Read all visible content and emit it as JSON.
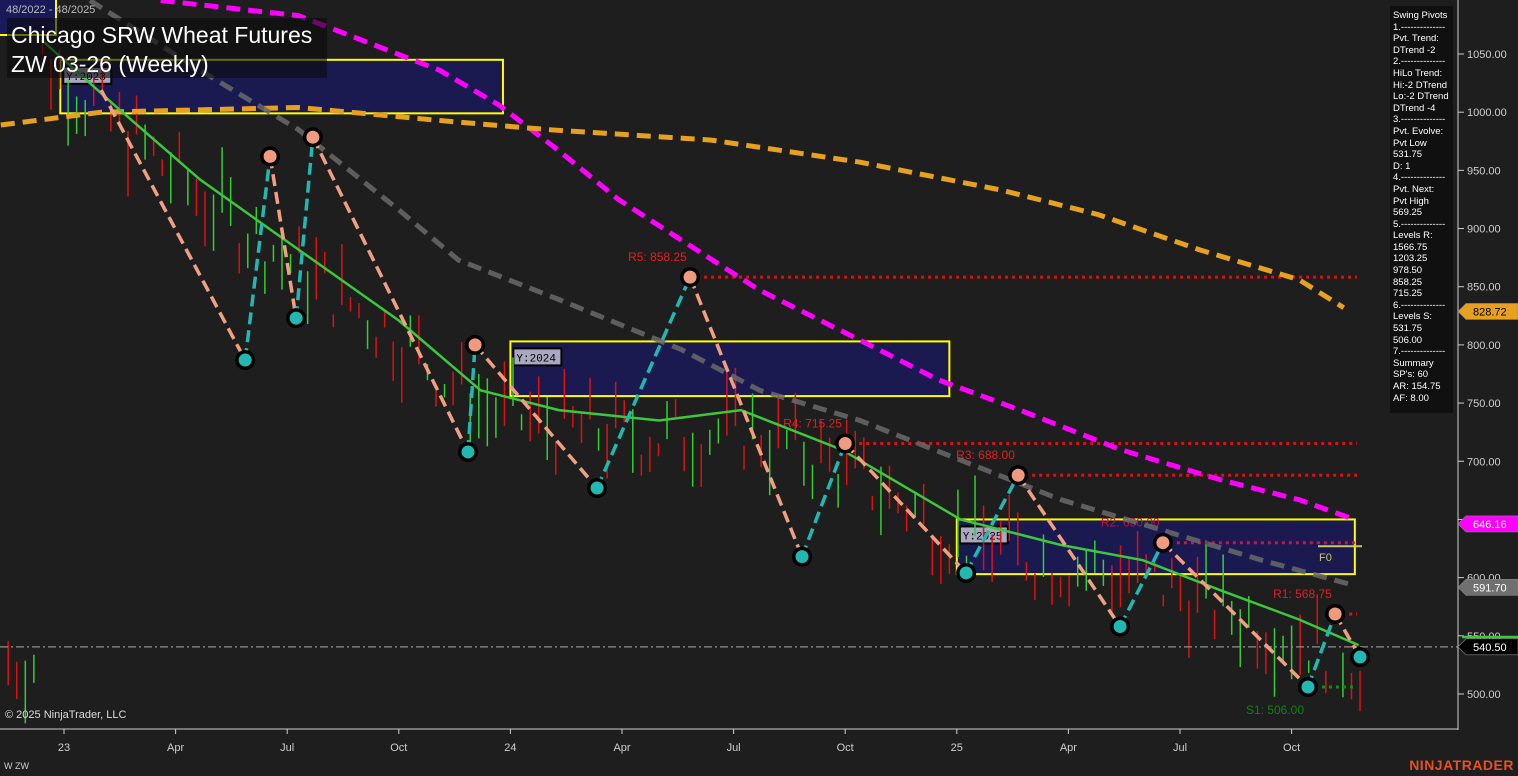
{
  "header": {
    "date_range": "48/2022 - 48/2025",
    "title": "Chicago SRW Wheat Futures",
    "subtitle": "ZW 03-26 (Weekly)"
  },
  "footer": {
    "copyright": "© 2025 NinjaTrader, LLC",
    "instrument": "W ZW",
    "brand": "NINJATRADER"
  },
  "panel": {
    "lines": [
      "Swing Pivots",
      "1.--------------",
      "Pvt. Trend:",
      "DTrend -2",
      "2.--------------",
      "HiLo Trend:",
      "Hi:-2 DTrend",
      "Lo:-2 DTrend",
      "DTrend -4",
      "3.--------------",
      "Pvt. Evolve:",
      "Pvt Low",
      "531.75",
      "D: 1",
      "4.--------------",
      "Pvt. Next:",
      "Pvt High",
      "569.25",
      "5.--------------",
      "Levels R:",
      "1566.75",
      "1203.25",
      "978.50",
      "858.25",
      "715.25",
      "6.--------------",
      "Levels S:",
      "531.75",
      "506.00",
      "7.--------------",
      "Summary",
      "SP's: 60",
      "AR: 154.75",
      "AF: 8.00"
    ]
  },
  "colors": {
    "magenta": "#ff00ff",
    "orange": "#e8a020",
    "gray": "#707070",
    "green": "#3cc83c",
    "pivot_down": "#f0a080",
    "pivot_up": "#20b8b0",
    "box": "#ffff00",
    "box_fill": "#1a1a5a",
    "res": "#e01010",
    "sup": "#108010"
  },
  "chart_data": {
    "type": "line",
    "title": "Chicago SRW Wheat Futures ZW 03-26 (Weekly)",
    "xlabel": "",
    "ylabel": "",
    "x_units": "months since Jan 2023",
    "ylim": [
      470,
      1096
    ],
    "y_ticks": [
      "500.00",
      "550.00",
      "600.00",
      "650.00",
      "700.00",
      "750.00",
      "800.00",
      "850.00",
      "900.00",
      "950.00",
      "1000.00",
      "1050.00"
    ],
    "y_tick_values": [
      500,
      550,
      600,
      650,
      700,
      750,
      800,
      850,
      900,
      950,
      1000,
      1050
    ],
    "x_ticks": [
      {
        "m": 0,
        "label": "23"
      },
      {
        "m": 3,
        "label": "Apr"
      },
      {
        "m": 6,
        "label": "Jul"
      },
      {
        "m": 9,
        "label": "Oct"
      },
      {
        "m": 12,
        "label": "24"
      },
      {
        "m": 15,
        "label": "Apr"
      },
      {
        "m": 18,
        "label": "Jul"
      },
      {
        "m": 21,
        "label": "Oct"
      },
      {
        "m": 24,
        "label": "25"
      },
      {
        "m": 27,
        "label": "Apr"
      },
      {
        "m": 30,
        "label": "Jul"
      },
      {
        "m": 33,
        "label": "Oct"
      }
    ],
    "series": [
      {
        "name": "magenta-ma",
        "color": "#ff00ff",
        "points": [
          [
            2.6,
            1096
          ],
          [
            6.3,
            1083
          ],
          [
            10.1,
            1036
          ],
          [
            11.7,
            1006
          ],
          [
            13.3,
            967
          ],
          [
            14.9,
            925
          ],
          [
            16.6,
            890
          ],
          [
            18.7,
            847
          ],
          [
            21.4,
            804
          ],
          [
            23.5,
            770
          ],
          [
            25.7,
            744
          ],
          [
            28.4,
            710
          ],
          [
            31.1,
            684
          ],
          [
            33.2,
            667
          ],
          [
            34.6,
            651
          ]
        ]
      },
      {
        "name": "orange-ma",
        "color": "#e8a020",
        "points": [
          [
            -1.7,
            989
          ],
          [
            1.0,
            1000
          ],
          [
            6.3,
            1004
          ],
          [
            10.4,
            992
          ],
          [
            13.0,
            985
          ],
          [
            17.4,
            976
          ],
          [
            21.4,
            957
          ],
          [
            25.2,
            933
          ],
          [
            27.8,
            912
          ],
          [
            30.5,
            882
          ],
          [
            33.2,
            856
          ],
          [
            34.4,
            832
          ]
        ]
      },
      {
        "name": "gray-ma",
        "color": "#6a6a6a",
        "points": [
          [
            0.7,
            1096
          ],
          [
            3.66,
            1036
          ],
          [
            6.3,
            985
          ],
          [
            9.0,
            916
          ],
          [
            10.6,
            873
          ],
          [
            13.3,
            839
          ],
          [
            16.6,
            796
          ],
          [
            18.7,
            761
          ],
          [
            21.4,
            735
          ],
          [
            24.1,
            701
          ],
          [
            26.8,
            667
          ],
          [
            29.5,
            641
          ],
          [
            32.2,
            615
          ],
          [
            34.6,
            594
          ]
        ]
      },
      {
        "name": "green-ma",
        "color": "#3cc83c",
        "points": [
          [
            -0.6,
            1062
          ],
          [
            1.5,
            1002
          ],
          [
            3.66,
            942
          ],
          [
            6.3,
            882
          ],
          [
            9.0,
            821
          ],
          [
            11.2,
            761
          ],
          [
            13.3,
            744
          ],
          [
            16.0,
            735
          ],
          [
            18.2,
            744
          ],
          [
            20.9,
            710
          ],
          [
            24.1,
            650
          ],
          [
            26.8,
            628
          ],
          [
            29.0,
            615
          ],
          [
            31.1,
            589
          ],
          [
            33.2,
            564
          ],
          [
            34.8,
            542
          ]
        ]
      }
    ],
    "pivots": [
      [
        1.0,
        1019,
        "H"
      ],
      [
        4.87,
        787,
        "L"
      ],
      [
        5.54,
        962,
        "H"
      ],
      [
        6.24,
        823,
        "L"
      ],
      [
        6.69,
        978.5,
        "H"
      ],
      [
        10.86,
        708,
        "L"
      ],
      [
        11.05,
        800,
        "H"
      ],
      [
        14.33,
        677,
        "L"
      ],
      [
        16.83,
        858.25,
        "H"
      ],
      [
        19.84,
        618,
        "L"
      ],
      [
        21.0,
        715.25,
        "H"
      ],
      [
        24.25,
        604,
        "L"
      ],
      [
        25.65,
        688,
        "H"
      ],
      [
        28.39,
        558,
        "L"
      ],
      [
        29.54,
        630,
        "H"
      ],
      [
        33.44,
        506,
        "L"
      ],
      [
        34.17,
        568.75,
        "H"
      ],
      [
        34.84,
        531.75,
        "L"
      ]
    ],
    "levels": [
      {
        "label": "R5: 858.25",
        "price": 858.25,
        "from": 16.83,
        "kind": "res"
      },
      {
        "label": "R4: 715.25",
        "price": 715.25,
        "from": 21.0,
        "kind": "res"
      },
      {
        "label": "R3: 688.00",
        "price": 688,
        "from": 25.65,
        "kind": "res"
      },
      {
        "label": "R2: 630.00",
        "price": 630,
        "from": 29.54,
        "kind": "res2"
      },
      {
        "label": "R1: 568.75",
        "price": 568.75,
        "from": 34.17,
        "kind": "res"
      },
      {
        "label": "S1: 506.00",
        "price": 506,
        "from": 33.44,
        "kind": "sup"
      }
    ],
    "year_boxes": [
      {
        "label": "Y:2023",
        "m0": -0.1,
        "m1": 11.8,
        "hi": 1045,
        "lo": 999
      },
      {
        "label": "Y:2024",
        "m0": 12.0,
        "m1": 23.8,
        "hi": 803,
        "lo": 756
      },
      {
        "label": "Y:2025",
        "m0": 24.0,
        "m1": 34.7,
        "hi": 650,
        "lo": 603
      }
    ],
    "fib_label": "F0",
    "fib_price": 627,
    "last_price": 540.5,
    "price_badges": [
      {
        "value": "828.72",
        "price": 828.72,
        "bg": "#e8a020",
        "fg": "#000"
      },
      {
        "value": "646.16",
        "price": 646.16,
        "bg": "#ff00ff",
        "fg": "#fff"
      },
      {
        "value": "591.70",
        "price": 591.7,
        "bg": "#707070",
        "fg": "#fff"
      },
      {
        "value": "540.50",
        "price": 540.5,
        "bg": "#000",
        "fg": "#fff"
      }
    ]
  }
}
